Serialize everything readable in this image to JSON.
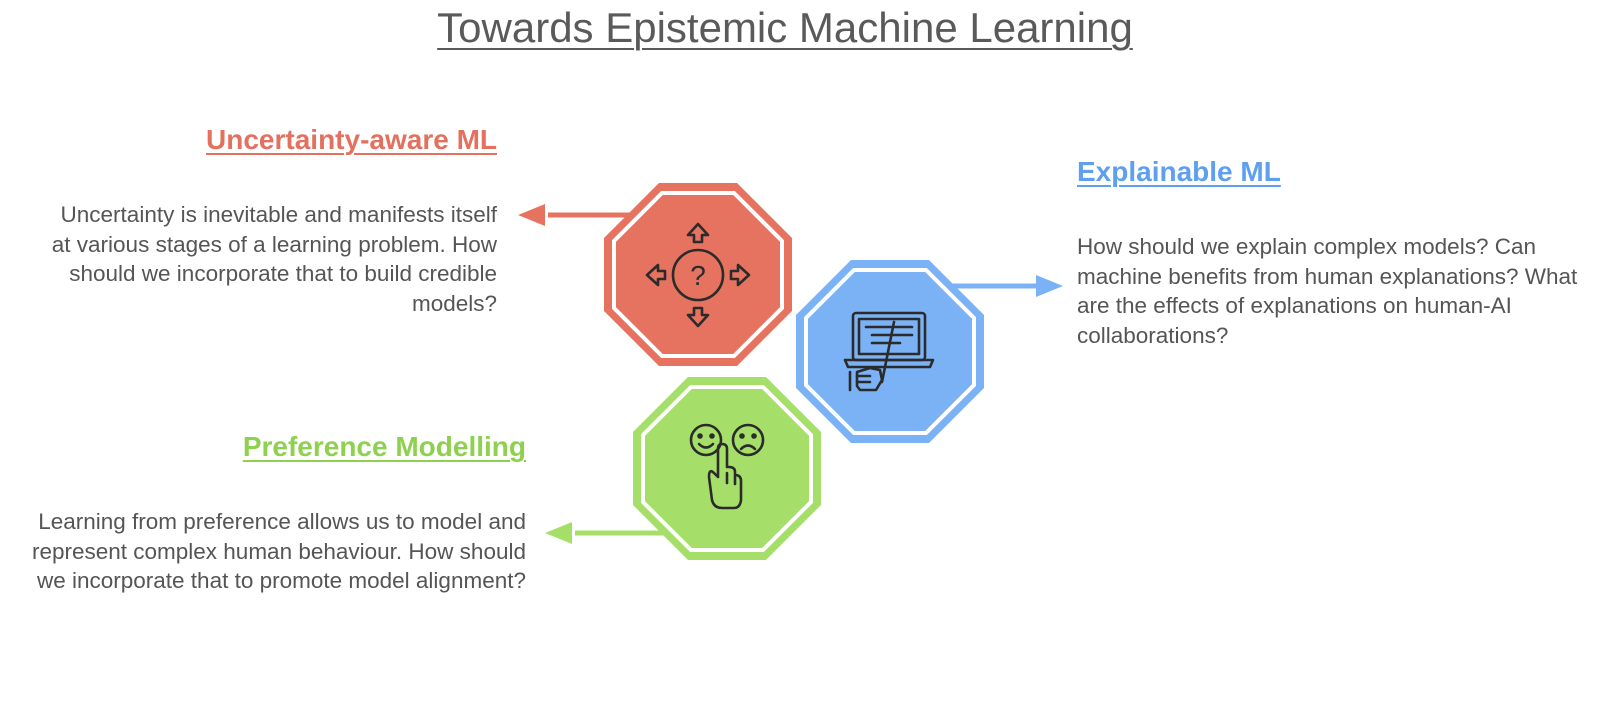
{
  "title": "Towards Epistemic Machine Learning",
  "colors": {
    "uncertainty": "#e5735f",
    "explainable": "#7ab2f5",
    "preference": "#a5df6a",
    "icon_stroke": "#2b2b2b",
    "text": "#555555"
  },
  "nodes": [
    {
      "id": "uncertainty",
      "heading": "Uncertainty-aware ML",
      "description": "Uncertainty is inevitable and manifests itself at various stages of a learning problem. How should we incorporate that to build credible models?",
      "icon": "question-arrows-icon"
    },
    {
      "id": "explainable",
      "heading": "Explainable ML",
      "description": "How should we explain complex models? Can machine benefits from human explanations? What are the effects of explanations on human-AI collaborations?",
      "icon": "laptop-presentation-icon"
    },
    {
      "id": "preference",
      "heading": "Preference Modelling",
      "description": "Learning from preference allows us to model and represent complex human behaviour. How should we incorporate that to promote model alignment?",
      "icon": "feedback-smiley-hand-icon"
    }
  ]
}
